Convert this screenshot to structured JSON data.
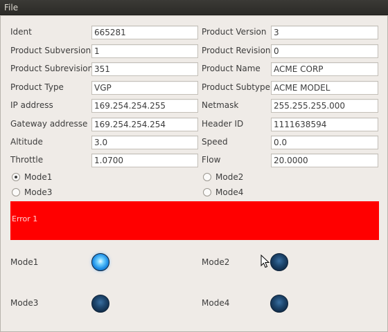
{
  "menubar": {
    "file_label": "File"
  },
  "form": {
    "ident": {
      "label": "Ident",
      "value": "665281"
    },
    "product_version": {
      "label": "Product Version",
      "value": "3"
    },
    "product_subversion": {
      "label": "Product Subversion",
      "value": "1"
    },
    "product_revision": {
      "label": "Product Revision",
      "value": "0"
    },
    "product_subrevision": {
      "label": "Product Subrevision",
      "value": "351"
    },
    "product_name": {
      "label": "Product Name",
      "value": "ACME CORP"
    },
    "product_type": {
      "label": "Product Type",
      "value": "VGP"
    },
    "product_subtype": {
      "label": "Product Subtype",
      "value": "ACME MODEL"
    },
    "ip_address": {
      "label": "IP address",
      "value": "169.254.254.255"
    },
    "netmask": {
      "label": "Netmask",
      "value": "255.255.255.000"
    },
    "gateway": {
      "label": "Gateway addresse",
      "value": "169.254.254.254"
    },
    "header_id": {
      "label": "Header ID",
      "value": "1111638594"
    },
    "altitude": {
      "label": "Altitude",
      "value": "3.0"
    },
    "speed": {
      "label": "Speed",
      "value": "0.0"
    },
    "throttle": {
      "label": "Throttle",
      "value": "1.0700"
    },
    "flow": {
      "label": "Flow",
      "value": "20.0000"
    }
  },
  "modes": {
    "mode1": {
      "label": "Mode1",
      "checked": true
    },
    "mode2": {
      "label": "Mode2",
      "checked": false
    },
    "mode3": {
      "label": "Mode3",
      "checked": false
    },
    "mode4": {
      "label": "Mode4",
      "checked": false
    }
  },
  "error": {
    "text": "Error 1",
    "color": "#ff0000"
  },
  "indicators": {
    "mode1": {
      "label": "Mode1",
      "state": "on"
    },
    "mode2": {
      "label": "Mode2",
      "state": "off"
    },
    "mode3": {
      "label": "Mode3",
      "state": "off"
    },
    "mode4": {
      "label": "Mode4",
      "state": "off"
    }
  },
  "colors": {
    "led_on": "#1e8ee6",
    "led_off": "#1e476f",
    "background": "#efebe7"
  }
}
